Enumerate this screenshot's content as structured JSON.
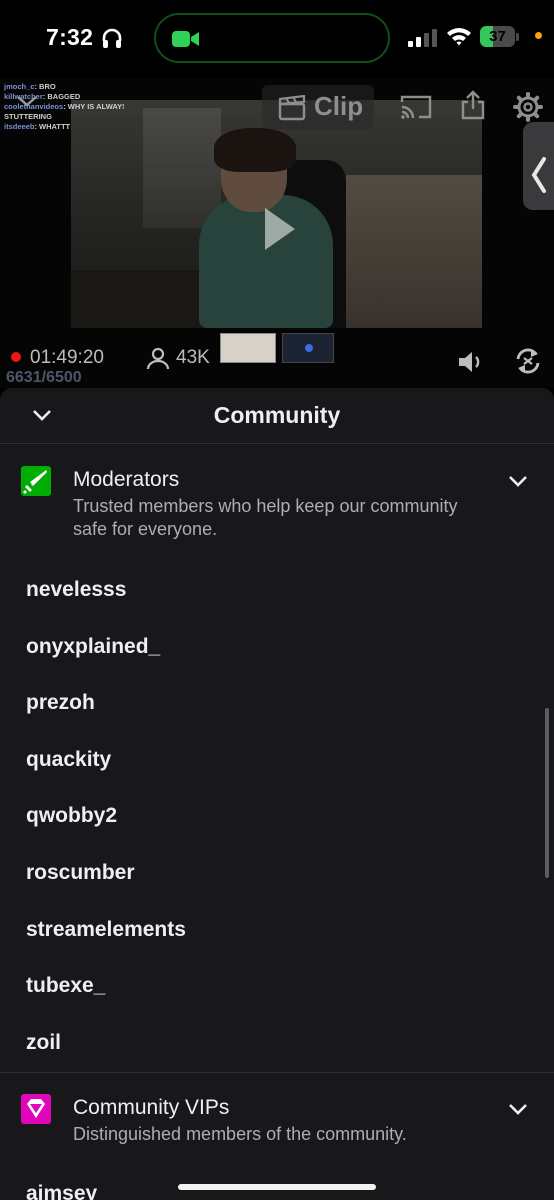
{
  "status_bar": {
    "time": "7:32",
    "battery_level": 37,
    "battery_label": "37",
    "icons": [
      "headphones-icon",
      "facetime-icon",
      "cellular-signal-icon",
      "wifi-icon",
      "battery-icon"
    ]
  },
  "player": {
    "clip_label": "Clip",
    "uptime": "01:49:20",
    "viewers": "43K",
    "chat_count": "6631/6500",
    "icons": [
      "chevron-down-icon",
      "clip-icon",
      "cast-icon",
      "share-icon",
      "gear-icon",
      "chevron-left-icon",
      "play-icon",
      "viewer-icon",
      "volume-icon",
      "rotate-icon"
    ],
    "chat_overlay": [
      {
        "user": "jmoch_c",
        "message": "BRO"
      },
      {
        "user": "killwatcher",
        "message": "BAGGED"
      },
      {
        "user": "coolethanvideos",
        "message": "WHY IS ALWAYS"
      },
      {
        "user": "",
        "message": "STUTTERING"
      },
      {
        "user": "itsdeeeb",
        "message": "WHATTT"
      }
    ]
  },
  "community": {
    "title": "Community",
    "moderators": {
      "title": "Moderators",
      "description": "Trusted members who help keep our community safe for everyone.",
      "members": [
        "nevelesss",
        "onyxplained_",
        "prezoh",
        "quackity",
        "qwobby2",
        "roscumber",
        "streamelements",
        "tubexe_",
        "zoil"
      ]
    },
    "vips": {
      "title": "Community VIPs",
      "description": "Distinguished members of the community.",
      "members": [
        "aimsey"
      ]
    }
  },
  "colors": {
    "moderator_badge": "#00ad03",
    "vip_badge": "#e005b9",
    "sheet_background": "#18181b",
    "live": "#e91916",
    "battery": "#35c759"
  }
}
